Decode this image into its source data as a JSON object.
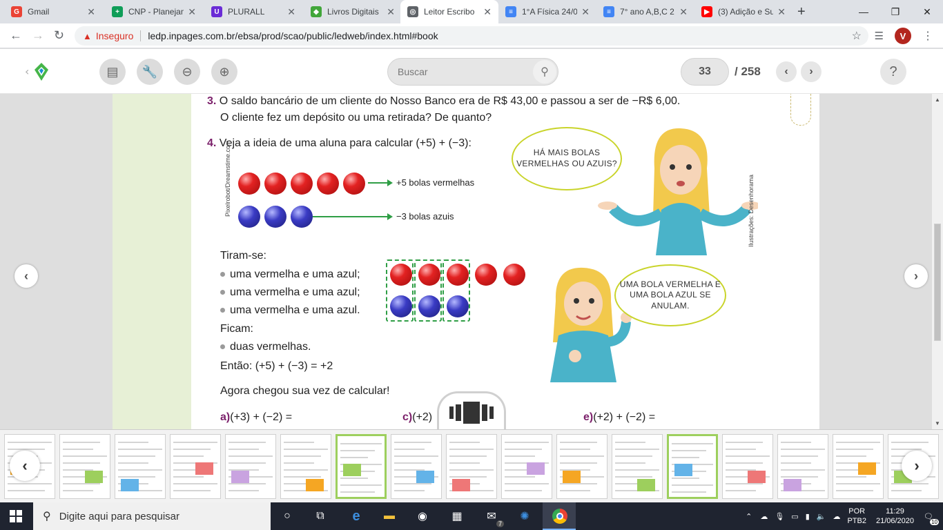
{
  "browser": {
    "tabs": [
      {
        "title": "Gmail",
        "color": "#ea4335",
        "letter": "G"
      },
      {
        "title": "CNP - Planejam",
        "color": "#0f9d58",
        "letter": "+"
      },
      {
        "title": "PLURALL",
        "color": "#6a2bd6",
        "letter": "U"
      },
      {
        "title": "Livros Digitais",
        "color": "#41a63a",
        "letter": "◆"
      },
      {
        "title": "Leitor Escribo",
        "color": "#5f6368",
        "letter": "◎"
      },
      {
        "title": "1°A Física 24/0",
        "color": "#4285f4",
        "letter": "≡"
      },
      {
        "title": "7° ano A,B,C 2",
        "color": "#4285f4",
        "letter": "≡"
      },
      {
        "title": "(3) Adição e Su",
        "color": "#ff0000",
        "letter": "▶"
      }
    ],
    "new_tab": "+",
    "insecure_label": "Inseguro",
    "url": "ledp.inpages.com.br/ebsa/prod/scao/public/ledweb/index.html#book",
    "profile_letter": "V"
  },
  "reader": {
    "search_placeholder": "Buscar",
    "current_page": "33",
    "total_pages": "/ 258",
    "help": "?"
  },
  "content": {
    "q3_num": "3.",
    "q3_line1": "O saldo bancário de um cliente do Nosso Banco era de R$ 43,00 e passou a ser de −R$ 6,00.",
    "q3_line2": "O cliente fez um depósito ou uma retirada? De quanto?",
    "q4_num": "4.",
    "q4_text": "Veja a ideia de uma aluna para calcular (+5) + (−3):",
    "red_label": "+5 bolas vermelhas",
    "blue_label": "−3 bolas azuis",
    "credit_balls": "Pixelrobot/Dreamstime.com",
    "credit_illus": "Ilustrações: Desenhorama",
    "bubble1": "HÁ MAIS BOLAS VERMELHAS OU AZUIS?",
    "bubble2": "UMA BOLA VERMELHA E UMA BOLA AZUL SE ANULAM.",
    "tiram": "Tiram-se:",
    "bullet1": "uma vermelha e uma azul;",
    "bullet2": "uma vermelha e uma azul;",
    "bullet3": "uma vermelha e uma azul.",
    "ficam": "Ficam:",
    "bullet4": "duas vermelhas.",
    "entao": "Então: (+5) + (−3) = +2",
    "agora": "Agora chegou sua vez de calcular!",
    "ex_a_label": "a)",
    "ex_a": "(+3) + (−2) =",
    "ex_c_label": "c)",
    "ex_c": "(+2)",
    "ex_e_label": "e)",
    "ex_e": "(+2) + (−2) ="
  },
  "taskbar": {
    "search_placeholder": "Digite aqui para pesquisar",
    "mail_badge": "7",
    "lang": "POR",
    "layout": "PTB2",
    "time": "11:29",
    "date": "21/06/2020",
    "notif": "10"
  }
}
